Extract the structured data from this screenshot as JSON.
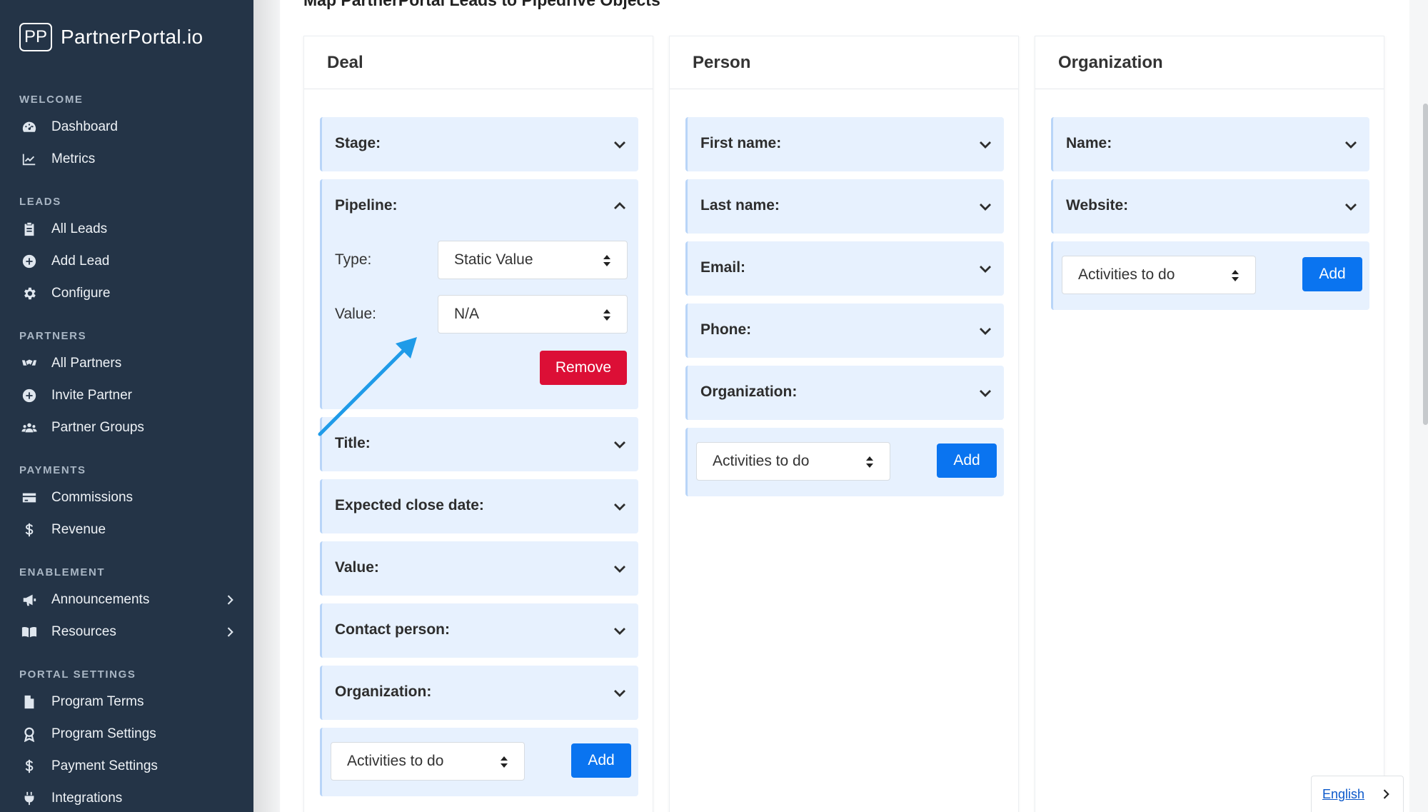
{
  "brand": {
    "logo": "PP",
    "name": "PartnerPortal.io"
  },
  "sidebar": {
    "sections": [
      {
        "title": "WELCOME",
        "items": [
          {
            "label": "Dashboard",
            "icon": "gauge-icon"
          },
          {
            "label": "Metrics",
            "icon": "line-chart-icon"
          }
        ]
      },
      {
        "title": "LEADS",
        "items": [
          {
            "label": "All Leads",
            "icon": "clipboard-icon"
          },
          {
            "label": "Add Lead",
            "icon": "plus-circle-icon"
          },
          {
            "label": "Configure",
            "icon": "gear-icon"
          }
        ]
      },
      {
        "title": "PARTNERS",
        "items": [
          {
            "label": "All Partners",
            "icon": "handshake-icon"
          },
          {
            "label": "Invite Partner",
            "icon": "plus-circle-icon"
          },
          {
            "label": "Partner Groups",
            "icon": "users-icon"
          }
        ]
      },
      {
        "title": "PAYMENTS",
        "items": [
          {
            "label": "Commissions",
            "icon": "credit-card-icon"
          },
          {
            "label": "Revenue",
            "icon": "dollar-icon"
          }
        ]
      },
      {
        "title": "ENABLEMENT",
        "items": [
          {
            "label": "Announcements",
            "icon": "megaphone-icon"
          },
          {
            "label": "Resources",
            "icon": "book-icon"
          }
        ]
      },
      {
        "title": "PORTAL SETTINGS",
        "items": [
          {
            "label": "Program Terms",
            "icon": "file-icon"
          },
          {
            "label": "Program Settings",
            "icon": "award-icon"
          },
          {
            "label": "Payment Settings",
            "icon": "dollar-icon"
          },
          {
            "label": "Integrations",
            "icon": "plug-icon"
          }
        ]
      }
    ]
  },
  "page": {
    "title": "Map PartnerPortal Leads to Pipedrive Objects"
  },
  "columns": {
    "deal": {
      "title": "Deal",
      "fields": [
        "Stage:",
        "Pipeline:",
        "Title:",
        "Expected close date:",
        "Value:",
        "Contact person:",
        "Organization:"
      ],
      "pipeline_editor": {
        "type_label": "Type:",
        "type_value": "Static Value",
        "value_label": "Value:",
        "value_value": "N/A",
        "remove_label": "Remove"
      },
      "add_select": "Activities to do",
      "add_label": "Add"
    },
    "person": {
      "title": "Person",
      "fields": [
        "First name:",
        "Last name:",
        "Email:",
        "Phone:",
        "Organization:"
      ],
      "add_select": "Activities to do",
      "add_label": "Add"
    },
    "organization": {
      "title": "Organization",
      "fields": [
        "Name:",
        "Website:"
      ],
      "add_select": "Activities to do",
      "add_label": "Add"
    }
  },
  "language": {
    "label": "English"
  },
  "colors": {
    "sidebar": "#243447",
    "field_bg": "#e7f1fe",
    "add_button": "#0a74f0",
    "remove_button": "#dc0f36",
    "annotation_arrow": "#1f9be8"
  }
}
